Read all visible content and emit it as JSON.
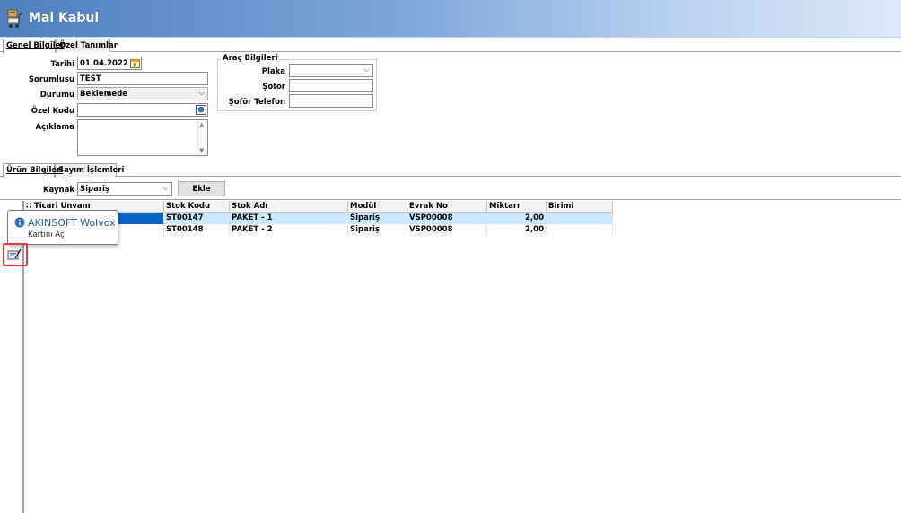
{
  "window": {
    "title": "Mal Kabul"
  },
  "tabs_top": [
    {
      "label": "Genel Bilgiler",
      "active": true
    },
    {
      "label": "Özel Tanımlar",
      "active": false
    }
  ],
  "form": {
    "tarihi_label": "Tarihi",
    "tarihi_value": "01.04.2022",
    "sorumlusu_label": "Sorumlusu",
    "sorumlusu_value": "TEST",
    "durumu_label": "Durumu",
    "durumu_value": "Beklemede",
    "ozel_kodu_label": "Özel Kodu",
    "ozel_kodu_value": "",
    "aciklama_label": "Açıklama"
  },
  "arac": {
    "group_title": "Araç Bilgileri",
    "plaka_label": "Plaka",
    "sofor_label": "Şoför",
    "sofor_telefon_label": "Şoför Telefon"
  },
  "tabs_bottom": [
    {
      "label": "Ürün Bilgileri",
      "active": true
    },
    {
      "label": "Sayım İşlemleri",
      "active": false
    }
  ],
  "kaynak": {
    "label": "Kaynak",
    "value": "Sipariş",
    "add_button": "Ekle"
  },
  "grid": {
    "columns": [
      "Ticari Unvanı",
      "Stok Kodu",
      "Stok Adı",
      "Modül",
      "Evrak No",
      "Miktarı",
      "Birimi"
    ],
    "rows": [
      {
        "ticari_unvani": "",
        "stok_kodu": "ST00147",
        "stok_adi": "PAKET - 1",
        "modul": "Sipariş",
        "evrak_no": "VSP00008",
        "miktari": "2,00",
        "birimi": ""
      },
      {
        "ticari_unvani": "",
        "stok_kodu": "ST00148",
        "stok_adi": "PAKET - 2",
        "modul": "Sipariş",
        "evrak_no": "VSP00008",
        "miktari": "2,00",
        "birimi": ""
      }
    ]
  },
  "tooltip": {
    "title": "AKINSOFT Wolvox",
    "subtitle": "Kartını Aç"
  },
  "colors": {
    "title_gradient_start": "#4f7fc0",
    "selection": "#cce8ff",
    "focus_cell": "#0a64c8",
    "highlight_border": "#e23a3a",
    "tooltip_title": "#1f57a8"
  },
  "icons": {
    "window": "warehouse-cart-icon",
    "date": "calendar-icon",
    "special_code_search": "search-card-icon",
    "dropdown": "chevron-down-icon",
    "info": "info-icon",
    "open_card": "open-card-icon"
  }
}
